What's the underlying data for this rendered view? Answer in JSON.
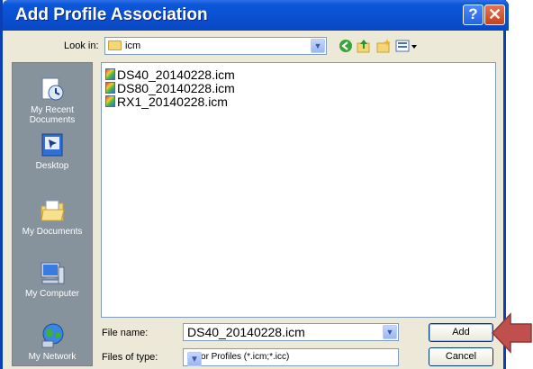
{
  "window": {
    "title": "Add Profile Association"
  },
  "titlebar": {
    "help_glyph": "?",
    "close_glyph": "✕"
  },
  "lookin": {
    "label": "Look in:",
    "value": "icm"
  },
  "places": [
    {
      "label": "My Recent Documents",
      "icon": "recent-documents-icon"
    },
    {
      "label": "Desktop",
      "icon": "desktop-icon"
    },
    {
      "label": "My Documents",
      "icon": "my-documents-icon"
    },
    {
      "label": "My Computer",
      "icon": "my-computer-icon"
    },
    {
      "label": "My Network",
      "icon": "my-network-icon"
    }
  ],
  "files": [
    "DS40_20140228.icm",
    "DS80_20140228.icm",
    "RX1_20140228.icm"
  ],
  "filename": {
    "label": "File name:",
    "value": "DS40_20140228.icm"
  },
  "filetype": {
    "label": "Files of type:",
    "value": "Color Profiles (*.icm;*.icc)"
  },
  "buttons": {
    "add": "Add",
    "cancel": "Cancel"
  },
  "colors": {
    "title_bar": "#0a57d8",
    "dialog_bg": "#ece9d8",
    "places_bg": "#86929c",
    "arrow": "#c0504d"
  }
}
